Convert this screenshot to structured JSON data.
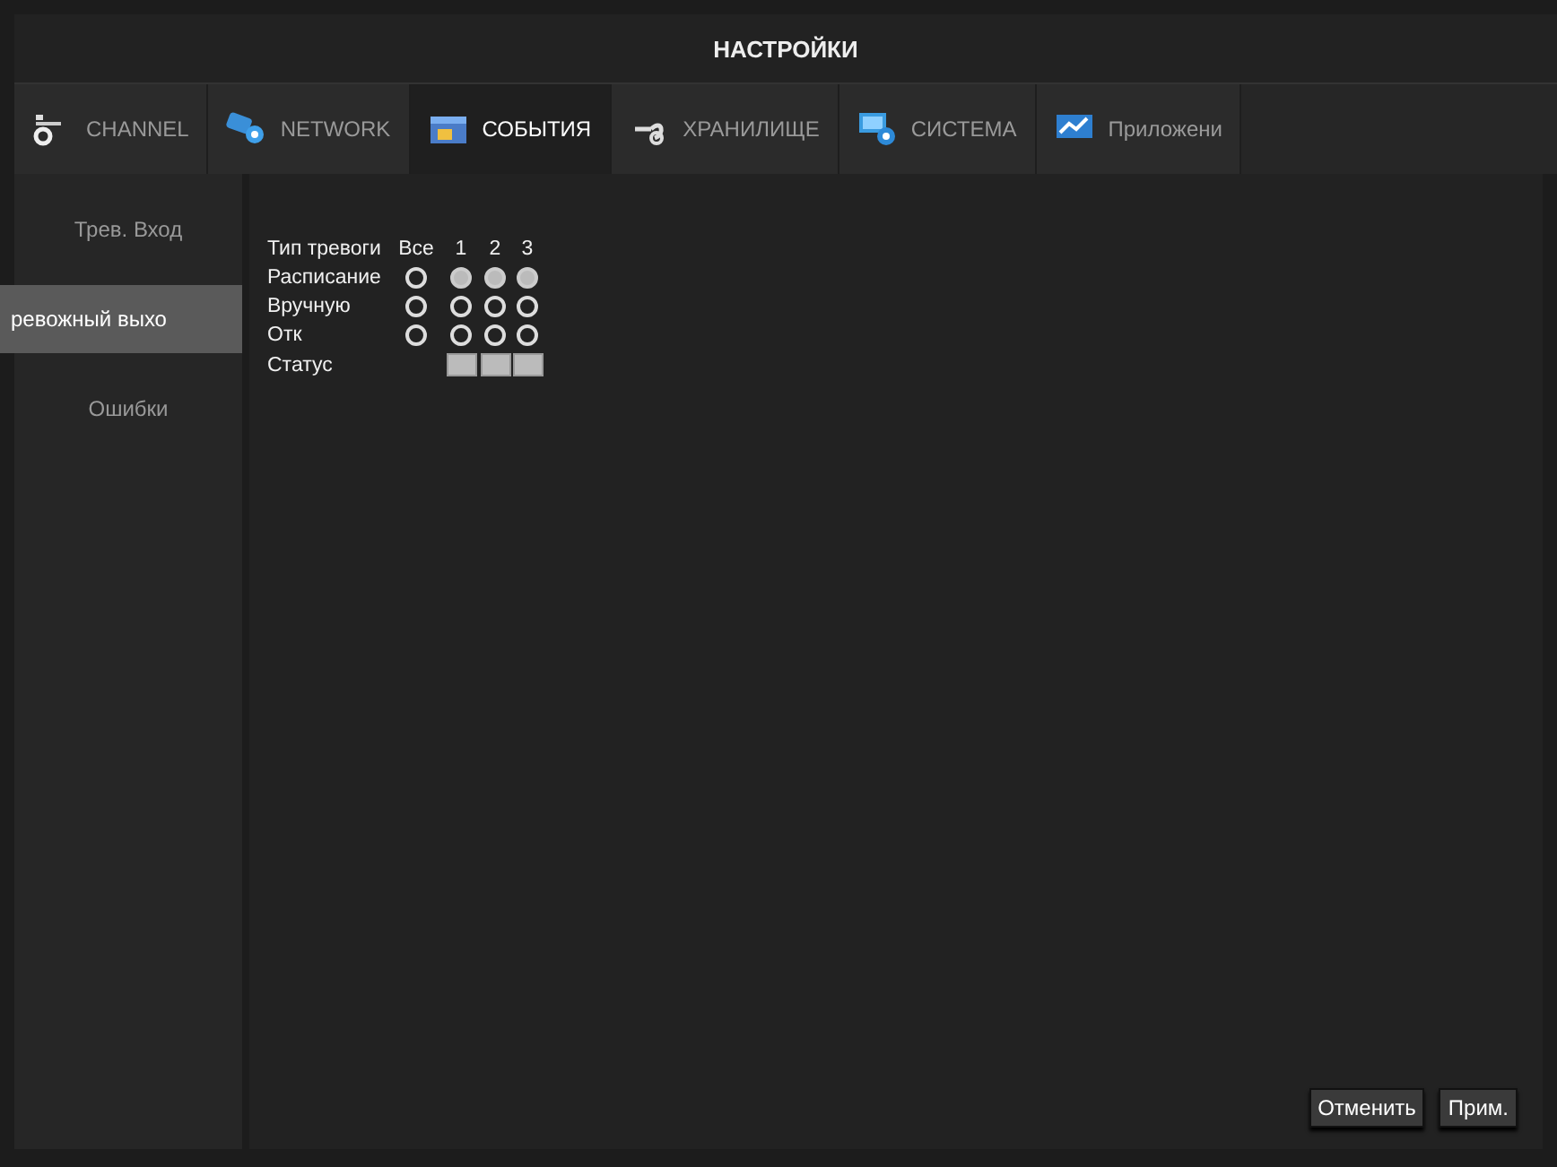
{
  "window": {
    "title": "НАСТРОЙКИ"
  },
  "tabs": [
    {
      "label": "CHANNEL",
      "kind": "camera",
      "selected": false
    },
    {
      "label": "NETWORK",
      "kind": "network",
      "selected": false
    },
    {
      "label": "СОБЫТИЯ",
      "kind": "events",
      "selected": true
    },
    {
      "label": "ХРАНИЛИЩЕ",
      "kind": "storage",
      "selected": false
    },
    {
      "label": "СИСТЕМА",
      "kind": "system",
      "selected": false
    },
    {
      "label": "Приложени",
      "kind": "apps",
      "selected": false
    }
  ],
  "sidebar": {
    "items": [
      {
        "label": "Трев. Вход",
        "selected": false
      },
      {
        "label": "ревожный выхо",
        "selected": true
      },
      {
        "label": "Ошибки",
        "selected": false
      }
    ]
  },
  "grid": {
    "header": {
      "label": "Тип тревоги",
      "columns": [
        "Все",
        "1",
        "2",
        "3"
      ]
    },
    "rows": [
      {
        "kind": "radio",
        "label": "Расписание",
        "cells": [
          {
            "selected": false
          },
          {
            "selected": true
          },
          {
            "selected": true
          },
          {
            "selected": true
          }
        ]
      },
      {
        "kind": "radio",
        "label": "Вручную",
        "cells": [
          {
            "selected": false
          },
          {
            "selected": false
          },
          {
            "selected": false
          },
          {
            "selected": false
          }
        ]
      },
      {
        "kind": "radio",
        "label": "Отк",
        "cells": [
          {
            "selected": false
          },
          {
            "selected": false
          },
          {
            "selected": false
          },
          {
            "selected": false
          }
        ]
      },
      {
        "kind": "status",
        "label": "Статус",
        "cells": [
          {
            "on": false
          },
          {
            "on": false
          },
          {
            "on": false
          }
        ]
      }
    ]
  },
  "buttons": [
    "Отменить",
    "Прим."
  ]
}
